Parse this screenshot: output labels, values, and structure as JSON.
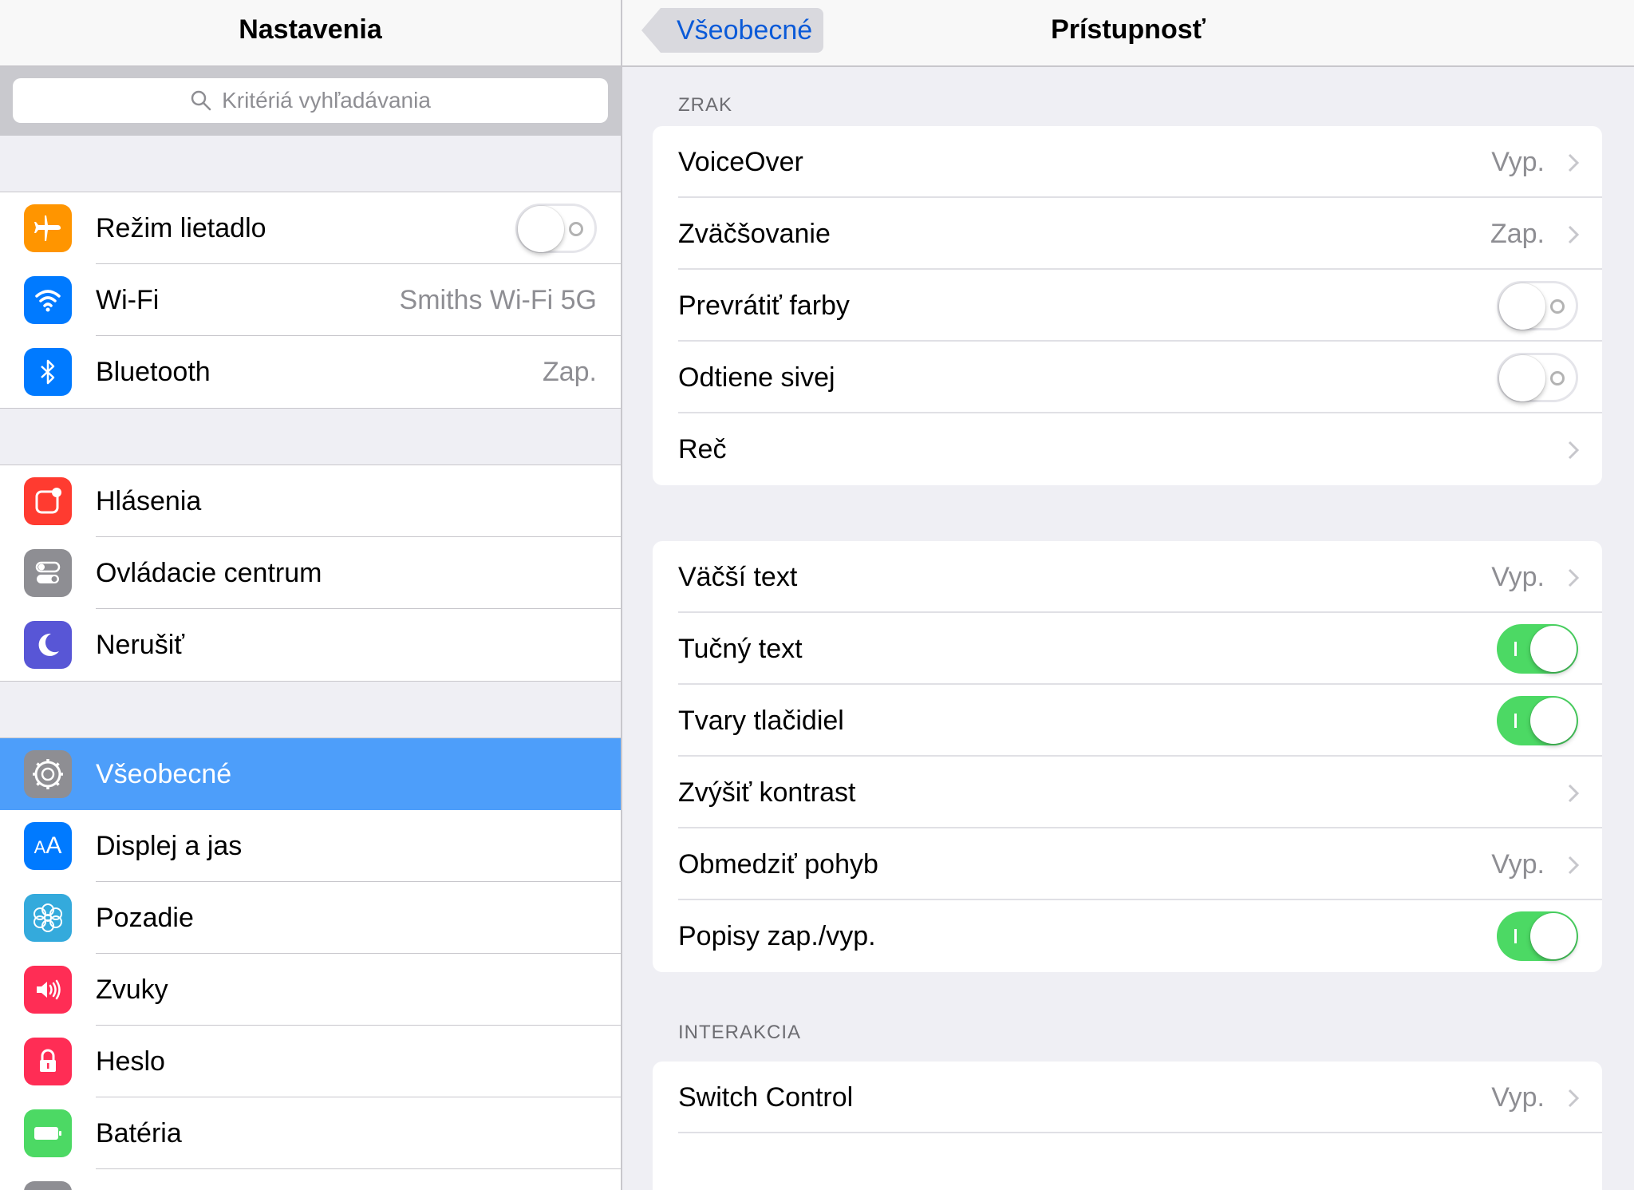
{
  "sidebar": {
    "title": "Nastavenia",
    "search_placeholder": "Kritériá vyhľadávania",
    "groups": [
      [
        {
          "label": "Režim lietadlo",
          "icon": "airplane-icon",
          "color": "#ff9500",
          "toggle": "off"
        },
        {
          "label": "Wi-Fi",
          "icon": "wifi-icon",
          "color": "#007aff",
          "value": "Smiths Wi-Fi 5G"
        },
        {
          "label": "Bluetooth",
          "icon": "bluetooth-icon",
          "color": "#007aff",
          "value": "Zap."
        }
      ],
      [
        {
          "label": "Hlásenia",
          "icon": "notifications-icon",
          "color": "#ff3b30"
        },
        {
          "label": "Ovládacie centrum",
          "icon": "control-center-icon",
          "color": "#8e8e93"
        },
        {
          "label": "Nerušiť",
          "icon": "moon-icon",
          "color": "#5856d6"
        }
      ],
      [
        {
          "label": "Všeobecné",
          "icon": "gear-icon",
          "color": "#8e8e93",
          "selected": true
        },
        {
          "label": "Displej a jas",
          "icon": "display-brightness-icon",
          "color": "#007aff"
        },
        {
          "label": "Pozadie",
          "icon": "wallpaper-icon",
          "color": "#34aadc"
        },
        {
          "label": "Zvuky",
          "icon": "speaker-icon",
          "color": "#ff2d55"
        },
        {
          "label": "Heslo",
          "icon": "lock-icon",
          "color": "#ff2d55"
        },
        {
          "label": "Batéria",
          "icon": "battery-icon",
          "color": "#4cd964"
        }
      ]
    ]
  },
  "detail": {
    "back_label": "Všeobecné",
    "title": "Prístupnosť",
    "sections": [
      {
        "header": "ZRAK",
        "rows": [
          {
            "label": "VoiceOver",
            "value": "Vyp.",
            "chevron": true
          },
          {
            "label": "Zväčšovanie",
            "value": "Zap.",
            "chevron": true
          },
          {
            "label": "Prevrátiť farby",
            "toggle": "off"
          },
          {
            "label": "Odtiene sivej",
            "toggle": "off"
          },
          {
            "label": "Reč",
            "chevron": true
          }
        ]
      },
      {
        "header": "",
        "rows": [
          {
            "label": "Väčší text",
            "value": "Vyp.",
            "chevron": true
          },
          {
            "label": "Tučný text",
            "toggle": "on"
          },
          {
            "label": "Tvary tlačidiel",
            "toggle": "on"
          },
          {
            "label": "Zvýšiť kontrast",
            "chevron": true
          },
          {
            "label": "Obmedziť pohyb",
            "value": "Vyp.",
            "chevron": true
          },
          {
            "label": "Popisy zap./vyp.",
            "toggle": "on"
          }
        ]
      },
      {
        "header": "INTERAKCIA",
        "rows": [
          {
            "label": "Switch Control",
            "value": "Vyp.",
            "chevron": true
          }
        ]
      }
    ]
  },
  "colors": {
    "accent": "#0a5ad8",
    "selected_row": "#4d9efa",
    "toggle_on": "#4cd964"
  }
}
